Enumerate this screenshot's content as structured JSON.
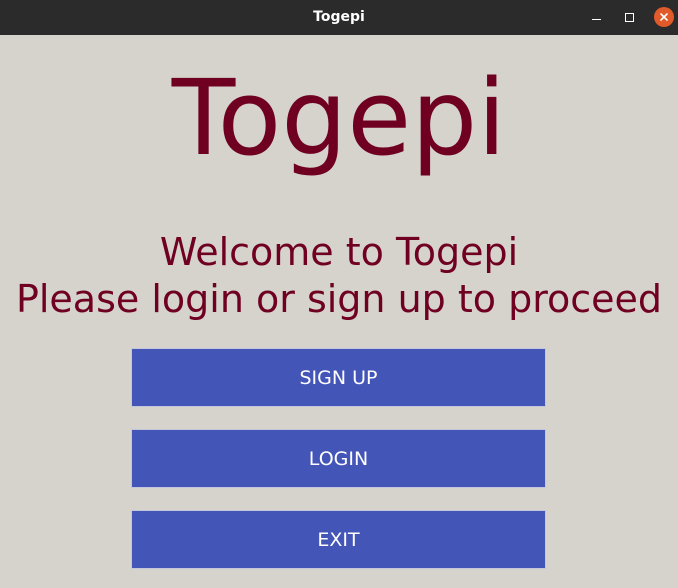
{
  "window": {
    "title": "Togepi"
  },
  "main": {
    "logo_text": "Togepi",
    "welcome_line1": "Welcome to Togepi",
    "welcome_line2": "Please login or sign up to proceed"
  },
  "buttons": {
    "signup_label": "SIGN UP",
    "login_label": "LOGIN",
    "exit_label": "EXIT"
  },
  "colors": {
    "background": "#d5d3cc",
    "titlebar": "#2b2b2b",
    "text_accent": "#6f0022",
    "button_bg": "#4455b8",
    "close_button": "#e05a2a"
  },
  "icons": {
    "minimize": "minimize-icon",
    "maximize": "maximize-icon",
    "close": "close-icon"
  }
}
